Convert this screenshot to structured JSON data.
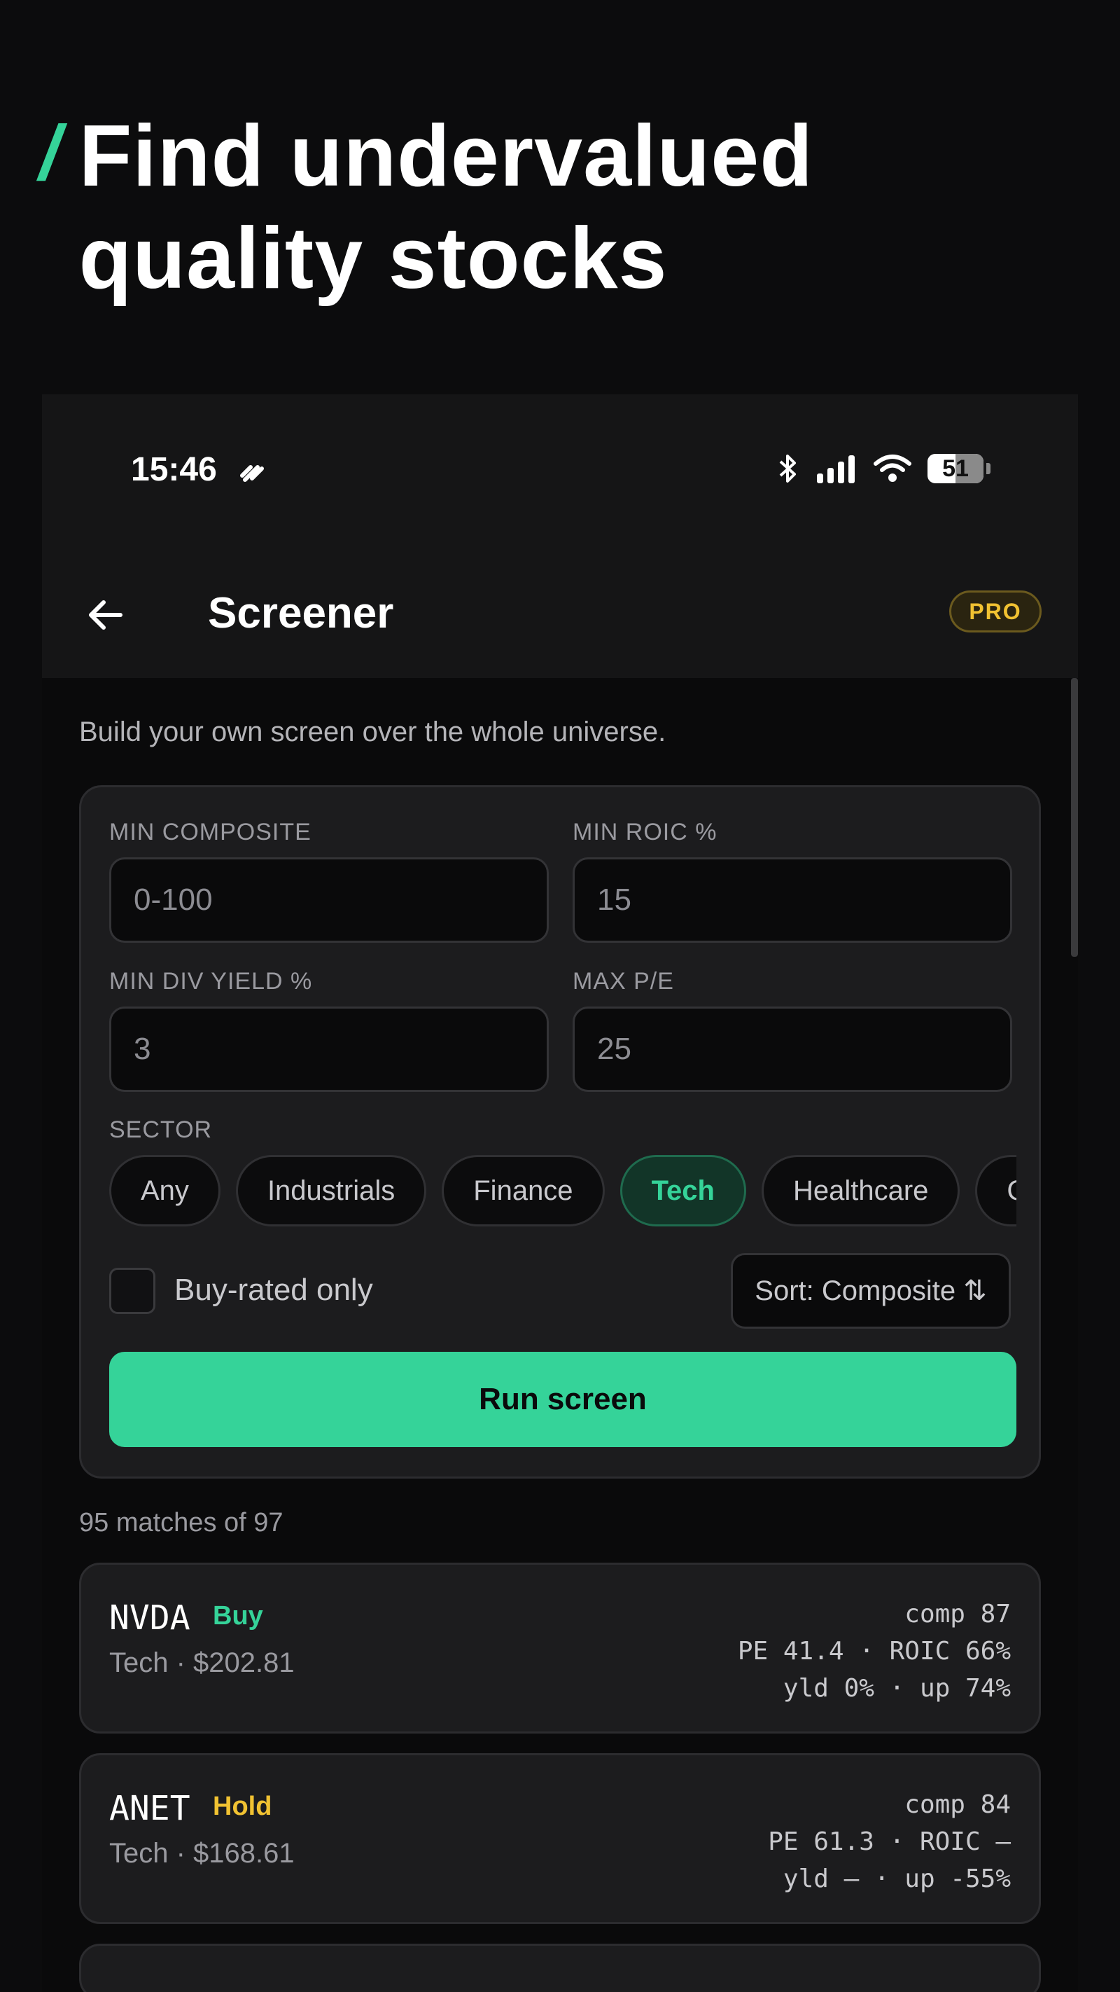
{
  "headline": {
    "slash": "/",
    "line1": "Find undervalued",
    "line2": "quality stocks"
  },
  "status_bar": {
    "time": "15:46",
    "battery": "51"
  },
  "topbar": {
    "title": "Screener",
    "badge": "PRO"
  },
  "intro": "Build your own screen over the whole universe.",
  "filters": {
    "min_composite": {
      "label": "MIN COMPOSITE",
      "placeholder": "0-100",
      "value": ""
    },
    "min_roic": {
      "label": "MIN ROIC %",
      "value": "15"
    },
    "min_div_yield": {
      "label": "MIN DIV YIELD %",
      "value": "3"
    },
    "max_pe": {
      "label": "MAX P/E",
      "value": "25"
    },
    "sector_label": "SECTOR",
    "sectors": [
      "Any",
      "Industrials",
      "Finance",
      "Tech",
      "Healthcare",
      "Consumer"
    ],
    "selected_sector": "Tech",
    "buy_rated_label": "Buy-rated only",
    "buy_rated_checked": false,
    "sort_label": "Sort: Composite ⇅",
    "run_label": "Run screen"
  },
  "results": {
    "summary": "95 matches of 97",
    "items": [
      {
        "ticker": "NVDA",
        "rating": "Buy",
        "rating_color": "#35d399",
        "sub": "Tech · $202.81",
        "line1": "comp 87",
        "line2": "PE 41.4 · ROIC 66%",
        "line3": "yld 0% · up 74%"
      },
      {
        "ticker": "ANET",
        "rating": "Hold",
        "rating_color": "#f1c232",
        "sub": "Tech · $168.61",
        "line1": "comp 84",
        "line2": "PE 61.3 · ROIC —",
        "line3": "yld — · up -55%"
      }
    ]
  },
  "colors": {
    "accent": "#35d399",
    "hold": "#f1c232",
    "background": "#0c0c0d",
    "card": "#1c1c1e"
  }
}
